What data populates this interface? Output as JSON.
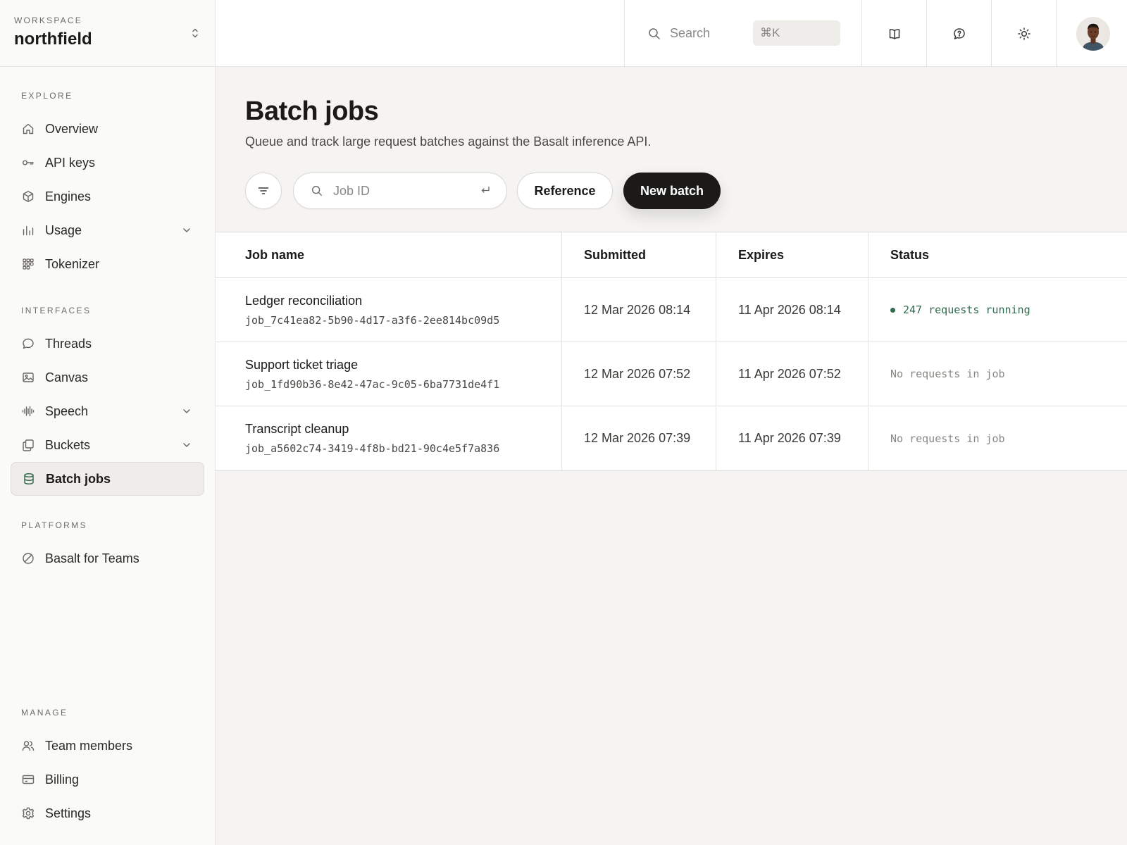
{
  "workspace": {
    "label": "WORKSPACE",
    "name": "northfield"
  },
  "sidebar": {
    "sections": [
      {
        "label": "EXPLORE",
        "items": [
          {
            "label": "Overview",
            "icon": "home-icon"
          },
          {
            "label": "API keys",
            "icon": "key-icon"
          },
          {
            "label": "Engines",
            "icon": "cube-icon"
          },
          {
            "label": "Usage",
            "icon": "bar-chart-icon",
            "expandable": true
          },
          {
            "label": "Tokenizer",
            "icon": "grid-icon"
          }
        ]
      },
      {
        "label": "INTERFACES",
        "items": [
          {
            "label": "Threads",
            "icon": "chat-bubble-icon"
          },
          {
            "label": "Canvas",
            "icon": "image-icon"
          },
          {
            "label": "Speech",
            "icon": "waveform-icon",
            "expandable": true
          },
          {
            "label": "Buckets",
            "icon": "copy-icon",
            "expandable": true
          },
          {
            "label": "Batch jobs",
            "icon": "database-icon",
            "active": true
          }
        ]
      },
      {
        "label": "PLATFORMS",
        "items": [
          {
            "label": "Basalt for Teams",
            "icon": "slash-circle-icon"
          }
        ]
      },
      {
        "label": "MANAGE",
        "items": [
          {
            "label": "Team members",
            "icon": "users-icon"
          },
          {
            "label": "Billing",
            "icon": "credit-card-icon"
          },
          {
            "label": "Settings",
            "icon": "gear-icon"
          }
        ]
      }
    ]
  },
  "topbar": {
    "search_placeholder": "Search",
    "shortcut": "⌘K",
    "buttons": [
      "book-icon",
      "help-chat-icon",
      "sun-icon"
    ],
    "avatar": "user-avatar"
  },
  "page": {
    "title": "Batch jobs",
    "subtitle": "Queue and track large request batches against the Basalt inference API.",
    "jobid_placeholder": "Job ID",
    "reference_label": "Reference",
    "new_batch_label": "New batch"
  },
  "table": {
    "columns": [
      "Job name",
      "Submitted",
      "Expires",
      "Status"
    ],
    "rows": [
      {
        "name": "Ledger reconciliation",
        "id": "job_7c41ea82-5b90-4d17-a3f6-2ee814bc09d5",
        "submitted": "12 Mar 2026 08:14",
        "expires": "11 Apr 2026 08:14",
        "status": "247 requests running",
        "running": true
      },
      {
        "name": "Support ticket triage",
        "id": "job_1fd90b36-8e42-47ac-9c05-6ba7731de4f1",
        "submitted": "12 Mar 2026 07:52",
        "expires": "11 Apr 2026 07:52",
        "status": "No requests in job",
        "running": false
      },
      {
        "name": "Transcript cleanup",
        "id": "job_a5602c74-3419-4f8b-bd21-90c4e5f7a836",
        "submitted": "12 Mar 2026 07:39",
        "expires": "11 Apr 2026 07:39",
        "status": "No requests in job",
        "running": false
      }
    ]
  },
  "colors": {
    "accent": "#2f6a4c",
    "primary_button": "#1b1a18",
    "background": "#f5f4f2"
  }
}
